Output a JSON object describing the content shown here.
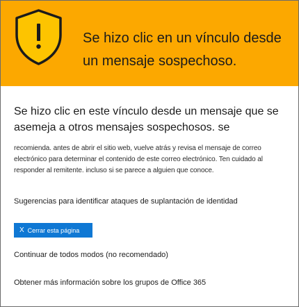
{
  "banner": {
    "title": "Se hizo clic en un vínculo desde un mensaje sospechoso.",
    "icon": "warning-shield-icon",
    "color": "#fca800"
  },
  "content": {
    "heading": "Se hizo clic en este vínculo desde un mensaje que se asemeja a otros mensajes sospechosos. se",
    "body": "recomienda. antes de abrir el sitio web, vuelve atrás y revisa el mensaje de correo electrónico para determinar el contenido de este correo electrónico. Ten cuidado al responder al remitente. incluso si se parece a alguien que conoce.",
    "tips_link": "Sugerencias para identificar ataques de suplantación de identidad"
  },
  "actions": {
    "close_icon": "X",
    "close_label": "Cerrar esta página",
    "close_color": "#0f78d4",
    "continue_link": "Continuar de todos modos (no recomendado)",
    "learn_more_link": "Obtener más información sobre los grupos de Office 365"
  }
}
